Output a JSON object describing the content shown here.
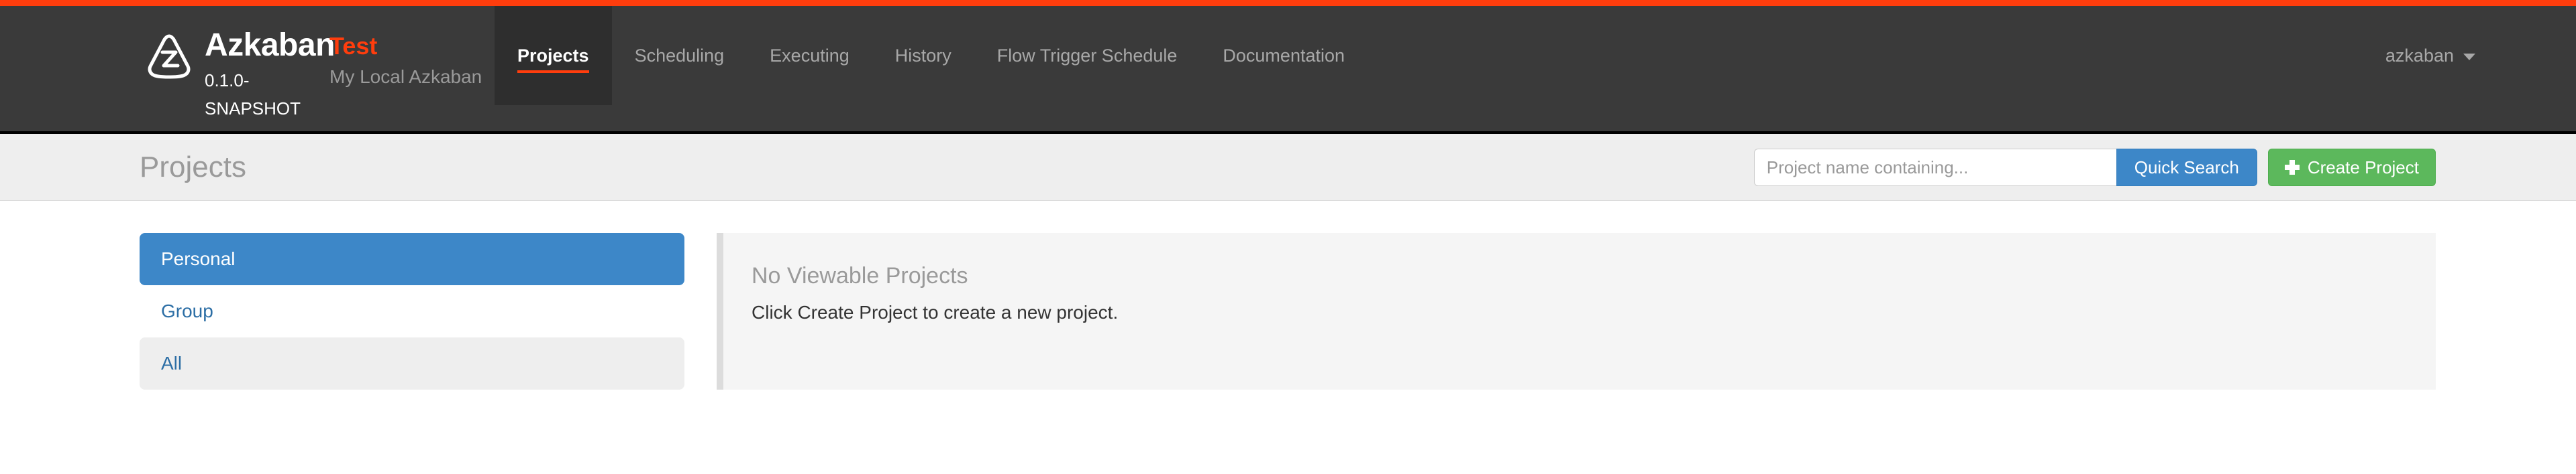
{
  "brand": {
    "name": "Azkaban",
    "version": "0.1.0-SNAPSHOT",
    "instance_name": "Test",
    "instance_desc": "My Local Azkaban",
    "logo_icon": "azkaban-triangle-z-icon",
    "accent_color": "#FF3D0D"
  },
  "nav": {
    "items": [
      {
        "label": "Projects",
        "active": true
      },
      {
        "label": "Scheduling",
        "active": false
      },
      {
        "label": "Executing",
        "active": false
      },
      {
        "label": "History",
        "active": false
      },
      {
        "label": "Flow Trigger Schedule",
        "active": false
      },
      {
        "label": "Documentation",
        "active": false
      }
    ],
    "user": {
      "label": "azkaban",
      "caret_icon": "chevron-down-icon"
    }
  },
  "header": {
    "title": "Projects",
    "search": {
      "placeholder": "Project name containing...",
      "value": "",
      "button_label": "Quick Search",
      "button_color": "#3D87C8"
    },
    "create_button": {
      "label": "Create Project",
      "icon": "plus-icon",
      "color": "#5CB85C"
    }
  },
  "sidebar": {
    "items": [
      {
        "label": "Personal",
        "state": "active"
      },
      {
        "label": "Group",
        "state": "default"
      },
      {
        "label": "All",
        "state": "shaded"
      }
    ]
  },
  "main": {
    "empty_state": {
      "title": "No Viewable Projects",
      "message": "Click Create Project to create a new project."
    }
  }
}
